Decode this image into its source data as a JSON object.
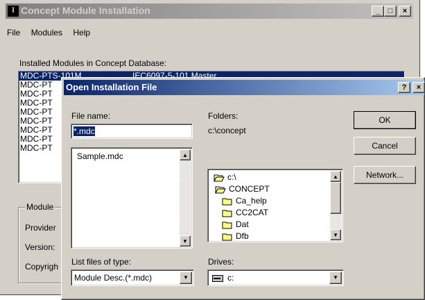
{
  "main_window": {
    "title": "Concept Module Installation",
    "menu": [
      "File",
      "Modules",
      "Help"
    ],
    "installed_label": "Installed Modules in Concept Database:",
    "modules": [
      {
        "name": "MDC-PTS-101M",
        "desc": "IEC6097-5-101 Master"
      },
      {
        "name": "MDC-PT",
        "desc": ""
      },
      {
        "name": "MDC-PT",
        "desc": ""
      },
      {
        "name": "MDC-PT",
        "desc": ""
      },
      {
        "name": "MDC-PT",
        "desc": ""
      },
      {
        "name": "MDC-PT",
        "desc": ""
      },
      {
        "name": "MDC-PT",
        "desc": ""
      },
      {
        "name": "MDC-PT",
        "desc": ""
      },
      {
        "name": "MDC-PT",
        "desc": ""
      }
    ],
    "module_group_label": "Module",
    "provider_label": "Provider",
    "version_label": "Version:",
    "copyright_label": "Copyrigh",
    "minimize": "_",
    "maximize": "□",
    "close": "×"
  },
  "dialog": {
    "title": "Open Installation File",
    "help_btn": "?",
    "close_btn": "×",
    "file_name_label": "File name:",
    "file_name_value": "*.mdc",
    "files": [
      "Sample.mdc"
    ],
    "folders_label": "Folders:",
    "current_folder": "c:\\concept",
    "folders": [
      {
        "name": "c:\\",
        "icon": "open-folder-icon",
        "indent": 0
      },
      {
        "name": "CONCEPT",
        "icon": "open-folder-icon",
        "indent": 1
      },
      {
        "name": "Ca_help",
        "icon": "folder-icon",
        "indent": 2
      },
      {
        "name": "CC2CAT",
        "icon": "folder-icon",
        "indent": 2
      },
      {
        "name": "Dat",
        "icon": "folder-icon",
        "indent": 2
      },
      {
        "name": "Dfb",
        "icon": "folder-icon",
        "indent": 2
      }
    ],
    "file_type_label": "List files of type:",
    "file_type_value": "Module Desc.(*.mdc)",
    "drives_label": "Drives:",
    "drive_value": "c:",
    "ok_label": "OK",
    "cancel_label": "Cancel",
    "network_label": "Network..."
  }
}
